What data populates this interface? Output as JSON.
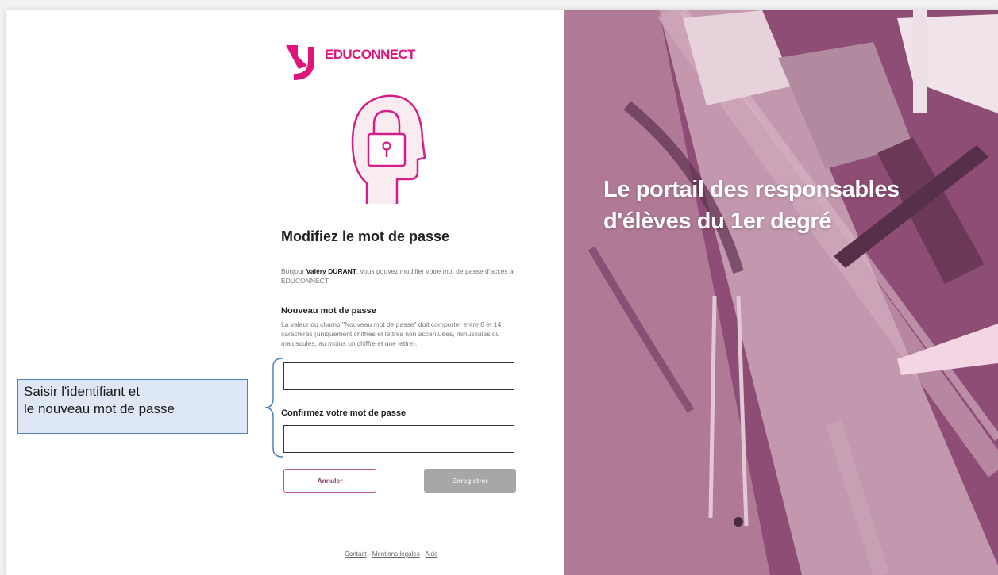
{
  "brand": {
    "name": "EDUCONNECT",
    "color": "#e0157b",
    "logo_icon": "educonnect-logo-icon"
  },
  "form": {
    "illustration_icon": "head-padlock-icon",
    "title": "Modifiez le mot de passe",
    "intro": {
      "prefix": "Bonjour ",
      "user": "Valéry DURANT",
      "suffix": ", vous pouvez modifier votre mot de passe d'accès à EDUCONNECT"
    },
    "new_password": {
      "label": "Nouveau mot de passe",
      "help": "La valeur du champ \"Nouveau mot de passe\" doit comporter entre 8 et 14 caractères (uniquement chiffres et lettres non accentuées, minuscules ou majuscules, au moins un chiffre et une lettre).",
      "value": ""
    },
    "confirm_password": {
      "label": "Confirmez votre mot de passe",
      "value": ""
    },
    "cancel_label": "Annuler",
    "save_label": "Enregistrer"
  },
  "footer": {
    "contact": "Contact",
    "sep1": " - ",
    "legal": "Mentions légales",
    "sep2": " - ",
    "help": "Aide"
  },
  "annotation": {
    "line1": "Saisir l'identifiant et",
    "line2": "le nouveau  mot de passe"
  },
  "hero": {
    "line1": "Le portail des responsables",
    "line2": "d'élèves du 1er degré",
    "tint": "#8e4d74"
  },
  "colors": {
    "accent": "#e0157b",
    "illustration_fill": "#f8ecf0",
    "button_disabled": "#a7a7a7",
    "annotation_bg": "#dde8f4",
    "annotation_border": "#4d81bd"
  }
}
